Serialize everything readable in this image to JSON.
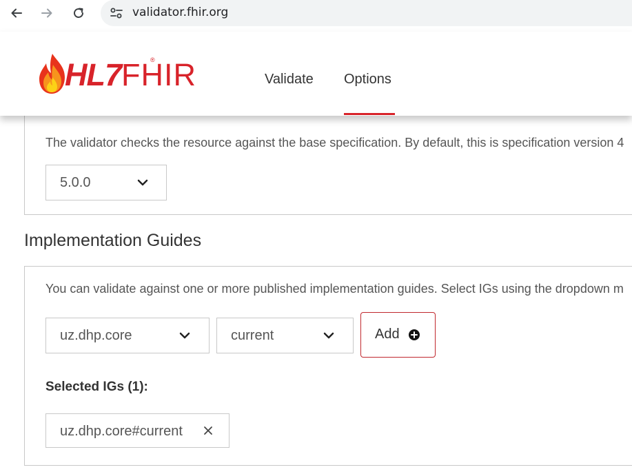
{
  "browser": {
    "url": "validator.fhir.org"
  },
  "header": {
    "logo": {
      "hl7": "HL7",
      "fhir": "FHIR",
      "reg": "®"
    },
    "nav": [
      {
        "label": "Validate"
      },
      {
        "label": "Options"
      }
    ],
    "active_tab": "Options",
    "brand_color": "#d8232a"
  },
  "version_section": {
    "description": "The validator checks the resource against the base specification. By default, this is specification version 4",
    "selected_version": "5.0.0"
  },
  "ig_section": {
    "title": "Implementation Guides",
    "description": "You can validate against one or more published implementation guides. Select IGs using the dropdown m",
    "ig_select": "uz.dhp.core",
    "version_select": "current",
    "add_label": "Add",
    "selected_label": "Selected IGs (1):",
    "selected": [
      {
        "label": "uz.dhp.core#current"
      }
    ]
  },
  "icons": {
    "back": "arrow-left-icon",
    "forward": "arrow-right-icon",
    "reload": "reload-icon",
    "site_info": "tune-icon",
    "dropdown": "chevron-down-icon",
    "add": "plus-circle-icon",
    "remove": "close-icon"
  }
}
